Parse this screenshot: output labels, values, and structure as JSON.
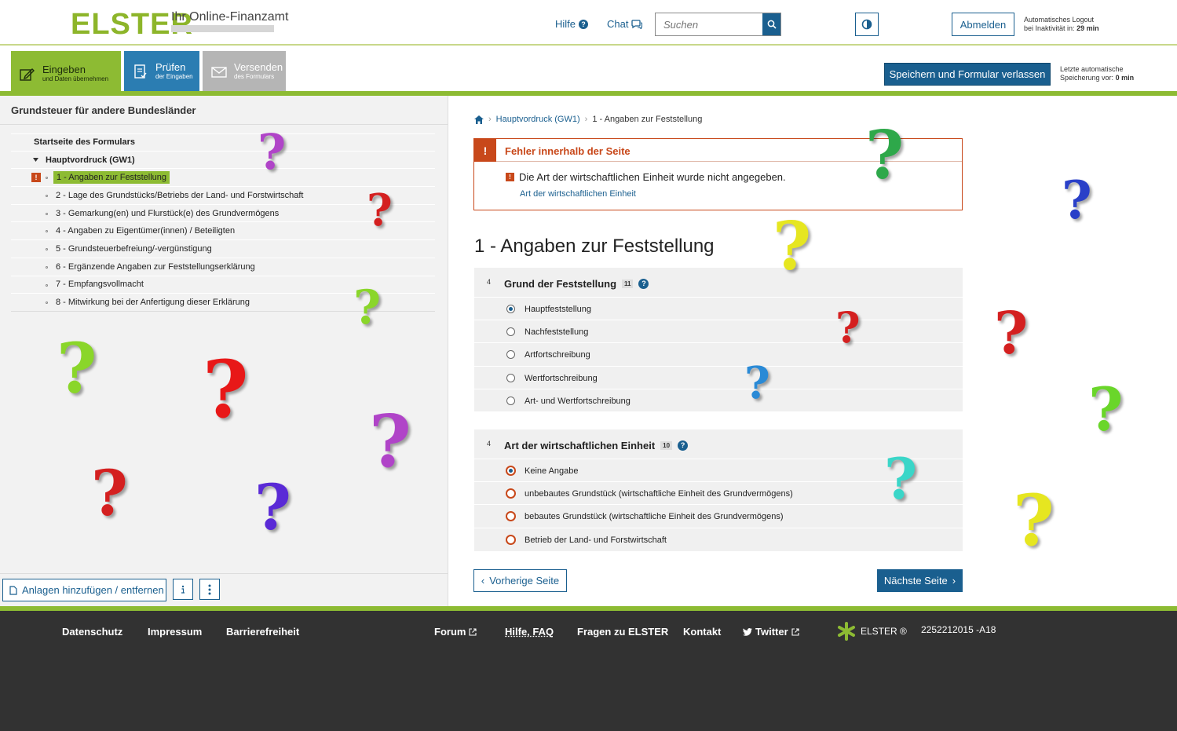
{
  "header": {
    "logo": "ELSTER",
    "logo_sub": "Ihr Online-Finanzamt",
    "help": "Hilfe",
    "chat": "Chat",
    "search_placeholder": "Suchen",
    "logout_button": "Abmelden",
    "logout_info_line1": "Automatisches Logout",
    "logout_info_line2": "bei Inaktivität in:",
    "logout_time": "29 min"
  },
  "steps": [
    {
      "title": "Eingeben",
      "sub": "und Daten übernehmen"
    },
    {
      "title": "Prüfen",
      "sub": "der Eingaben"
    },
    {
      "title": "Versenden",
      "sub": "des Formulars"
    }
  ],
  "save": {
    "button": "Speichern und Formular verlassen",
    "info_line1": "Letzte automatische",
    "info_line2": "Speicherung vor:",
    "info_time": "0 min"
  },
  "sidebar": {
    "title": "Grundsteuer für andere Bundesländer",
    "start": "Startseite des Formulars",
    "group": "Hauptvordruck (GW1)",
    "items": [
      "1 - Angaben zur Feststellung",
      "2 - Lage des Grundstücks/Betriebs der Land- und Forstwirtschaft",
      "3 - Gemarkung(en) und Flurstück(e) des Grundvermögens",
      "4 - Angaben zu Eigentümer(innen) / Beteiligten",
      "5 - Grundsteuerbefreiung/-vergünstigung",
      "6 - Ergänzende Angaben zur Feststellungserklärung",
      "7 - Empfangsvollmacht",
      "8 - Mitwirkung bei der Anfertigung dieser Erklärung"
    ],
    "error_mark": "!",
    "attachments_button": "Anlagen hinzufügen / entfernen"
  },
  "breadcrumb": {
    "level1": "Hauptvordruck (GW1)",
    "level2": "1 - Angaben zur Feststellung"
  },
  "error": {
    "mark": "!",
    "title": "Fehler innerhalb der Seite",
    "message": "Die Art der wirtschaftlichen Einheit wurde nicht angegeben.",
    "link": "Art der wirtschaftlichen Einheit"
  },
  "page_title": "1 - Angaben zur Feststellung",
  "field1": {
    "num": "4",
    "title": "Grund der Feststellung",
    "badge": "11",
    "options": [
      "Hauptfeststellung",
      "Nachfeststellung",
      "Artfortschreibung",
      "Wertfortschreibung",
      "Art- und Wertfortschreibung"
    ],
    "selected": 0
  },
  "field2": {
    "num": "4",
    "title": "Art der wirtschaftlichen Einheit",
    "badge": "10",
    "options": [
      "Keine Angabe",
      "unbebautes Grundstück (wirtschaftliche Einheit des Grundvermögens)",
      "bebautes Grundstück (wirtschaftliche Einheit des Grundvermögens)",
      "Betrieb der Land- und Forstwirtschaft"
    ],
    "selected": 0
  },
  "nav_buttons": {
    "prev": "Vorherige Seite",
    "next": "Nächste Seite"
  },
  "footer": {
    "links": [
      "Datenschutz",
      "Impressum",
      "Barrierefreiheit",
      "Forum",
      "Hilfe, FAQ",
      "Fragen zu ELSTER",
      "Kontakt",
      "Twitter"
    ],
    "brand": "ELSTER ®",
    "version": "2252212015 -A18"
  },
  "overlay": {
    "glyph": "?",
    "colors": [
      "#b044c8",
      "#d42020",
      "#8ad62a",
      "#e6e620",
      "#2ea84a",
      "#2a40c8",
      "#2a8ad6",
      "#3ad6c8",
      "#5a2ad6"
    ]
  },
  "colors": {
    "brand_green": "#8dbb33",
    "brand_blue": "#1a5f8f",
    "error": "#c8481a",
    "footer_bg": "#323232"
  }
}
